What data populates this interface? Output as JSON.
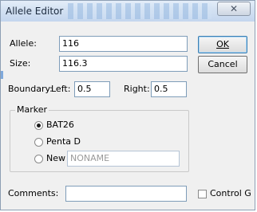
{
  "window": {
    "title": "Allele Editor",
    "close_glyph": "✕"
  },
  "allele": {
    "label": "Allele:",
    "value": "116"
  },
  "size": {
    "label": "Size:",
    "value": "116.3"
  },
  "buttons": {
    "ok": "OK",
    "cancel": "Cancel"
  },
  "boundary": {
    "label": "Boundary:",
    "left_label": "Left:",
    "left_value": "0.5",
    "right_label": "Right:",
    "right_value": "0.5"
  },
  "marker": {
    "legend": "Marker",
    "options": [
      {
        "label": "BAT26",
        "selected": true
      },
      {
        "label": "Penta D",
        "selected": false
      },
      {
        "label": "New",
        "selected": false
      }
    ],
    "new_value": "NONAME"
  },
  "comments": {
    "label": "Comments:",
    "value": ""
  },
  "control": {
    "label": "Control Gene",
    "checked": false
  }
}
